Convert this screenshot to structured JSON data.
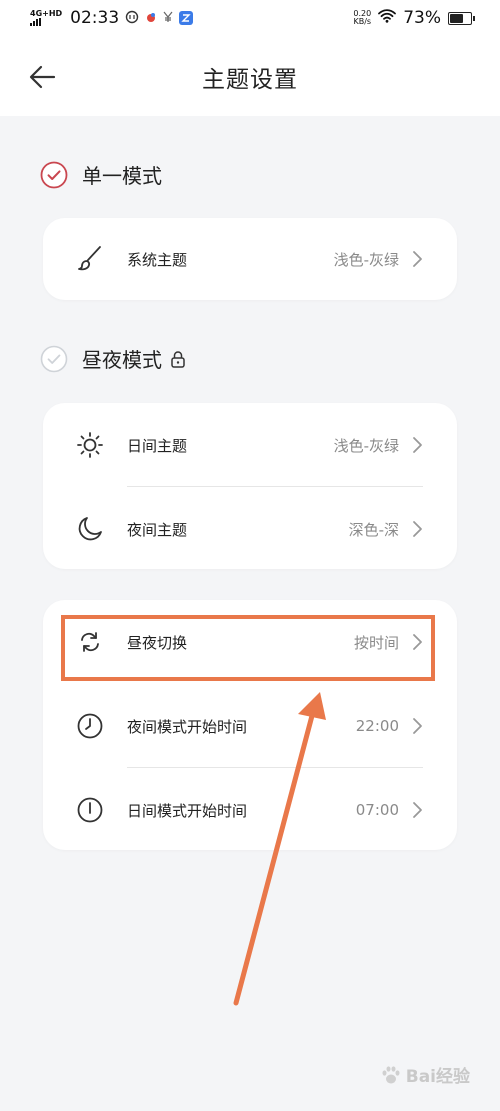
{
  "status_bar": {
    "network": "4G+HD",
    "time": "02:33",
    "speed_value": "0.20",
    "speed_unit": "KB/s",
    "battery": "73%",
    "battery_level": 0.73
  },
  "header": {
    "title": "主题设置",
    "back_icon": "arrow-left-icon"
  },
  "single_mode": {
    "label": "单一模式",
    "selected": true,
    "accent_color": "#c9464f",
    "rows": [
      {
        "label": "系统主题",
        "value": "浅色-灰绿",
        "icon": "brush-icon"
      }
    ]
  },
  "day_night_mode": {
    "label": "昼夜模式",
    "selected": false,
    "locked": true,
    "themes": [
      {
        "label": "日间主题",
        "value": "浅色-灰绿",
        "icon": "sun-icon"
      },
      {
        "label": "夜间主题",
        "value": "深色-深",
        "icon": "moon-icon"
      }
    ],
    "schedule": [
      {
        "label": "昼夜切换",
        "value": "按时间",
        "icon": "switch-icon"
      },
      {
        "label": "夜间模式开始时间",
        "value": "22:00",
        "icon": "clock-icon"
      },
      {
        "label": "日间模式开始时间",
        "value": "07:00",
        "icon": "clock-icon"
      }
    ]
  },
  "annotation": {
    "color": "#e9784a"
  },
  "watermark": {
    "text": "Bai经验"
  }
}
